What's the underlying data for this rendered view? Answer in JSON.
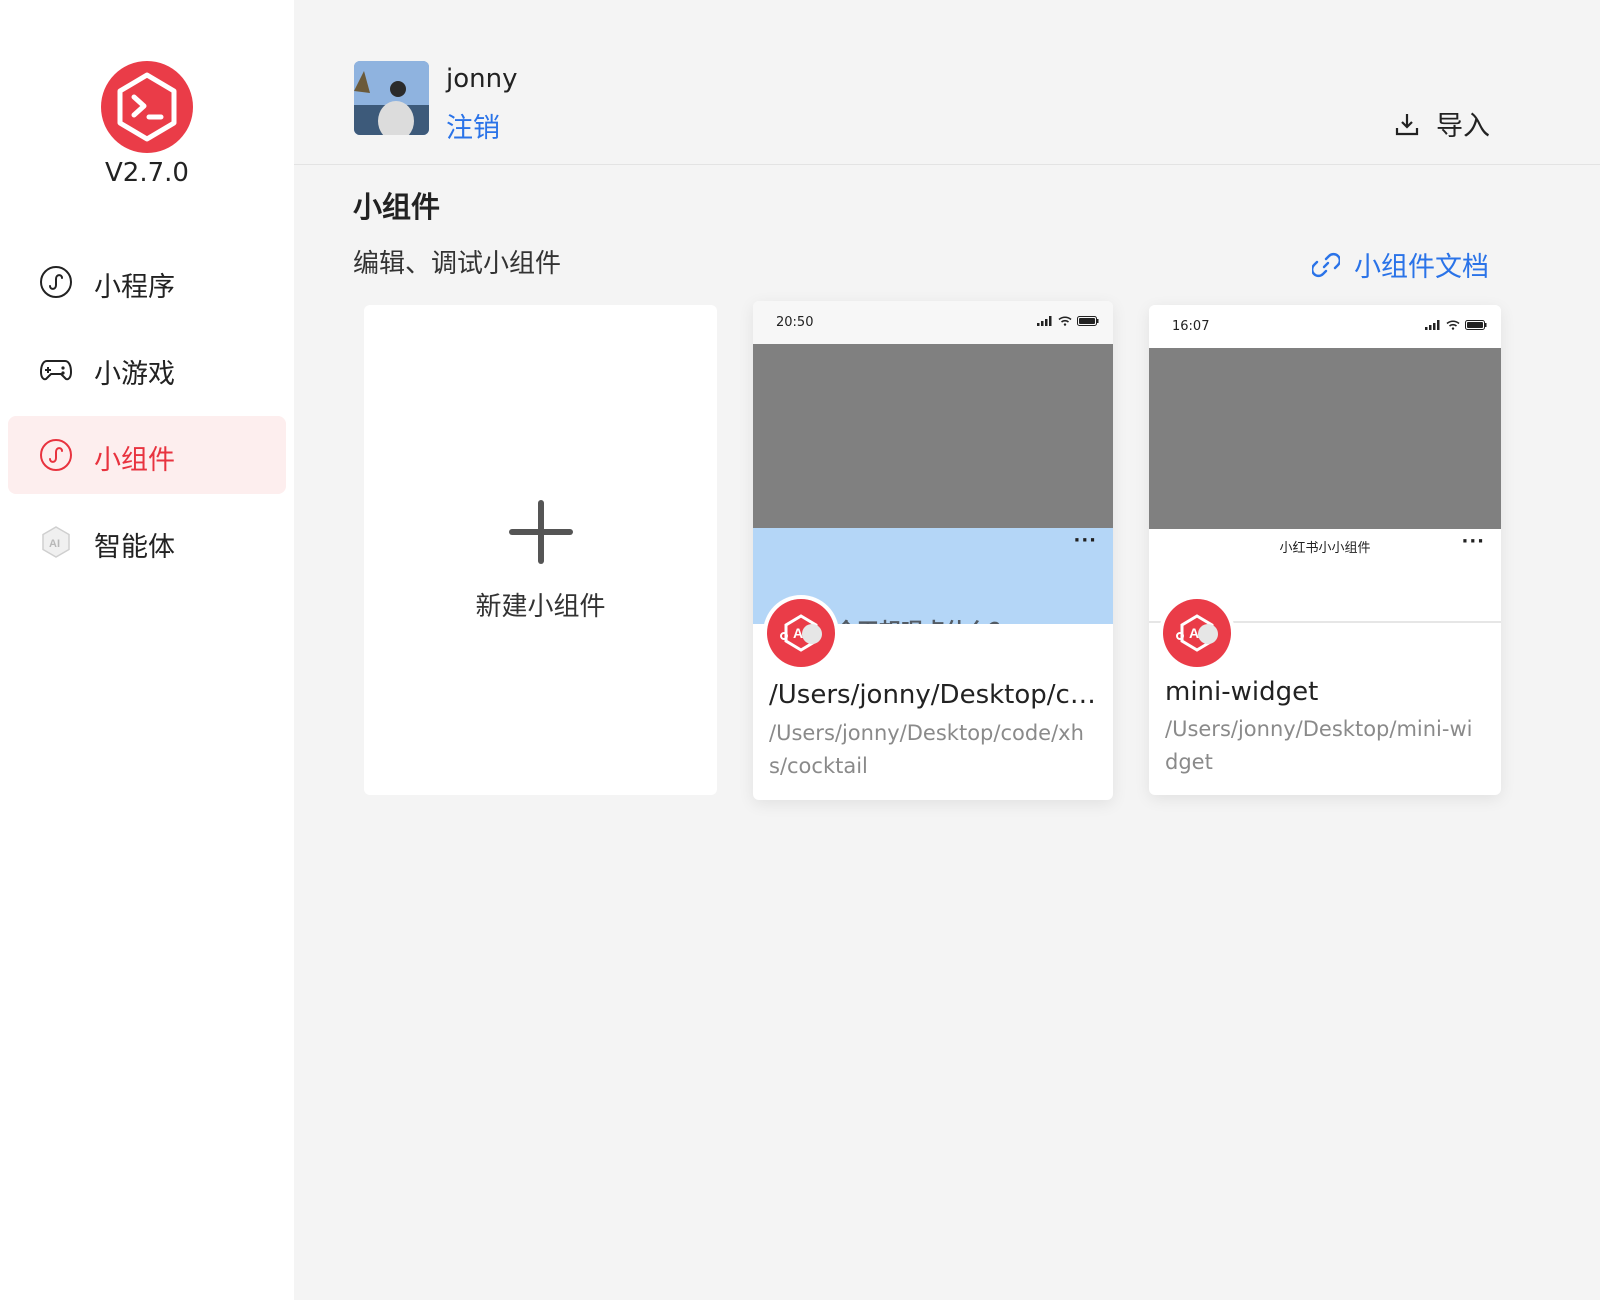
{
  "window": {
    "dots": [
      "close",
      "minimize",
      "maximize"
    ]
  },
  "sidebar": {
    "version": "V2.7.0",
    "items": [
      {
        "label": "小程序",
        "icon": "mini-program-icon",
        "active": false
      },
      {
        "label": "小游戏",
        "icon": "gamepad-icon",
        "active": false
      },
      {
        "label": "小组件",
        "icon": "mini-program-icon",
        "active": true
      },
      {
        "label": "智能体",
        "icon": "ai-agent-icon",
        "active": false
      }
    ]
  },
  "header": {
    "username": "jonny",
    "logout": "注销",
    "import": "导入"
  },
  "section": {
    "title": "小组件",
    "subtitle": "编辑、调试小组件",
    "doc_link": "小组件文档"
  },
  "new_card": {
    "label": "新建小组件"
  },
  "projects": [
    {
      "name": "/Users/jonny/Desktop/co...",
      "path": "/Users/jonny/Desktop/code/xhs/cocktail",
      "preview": {
        "time": "20:50",
        "text": "今天想喝点什么？",
        "more": "···"
      }
    },
    {
      "name": "mini-widget",
      "path": "/Users/jonny/Desktop/mini-widget",
      "preview": {
        "time": "16:07",
        "title": "小红书小小组件",
        "more": "···"
      }
    }
  ],
  "colors": {
    "brand_red": "#ea3c48",
    "link_blue": "#2a73e8",
    "active_bg": "#fdeeee",
    "main_bg": "#f4f4f4"
  }
}
